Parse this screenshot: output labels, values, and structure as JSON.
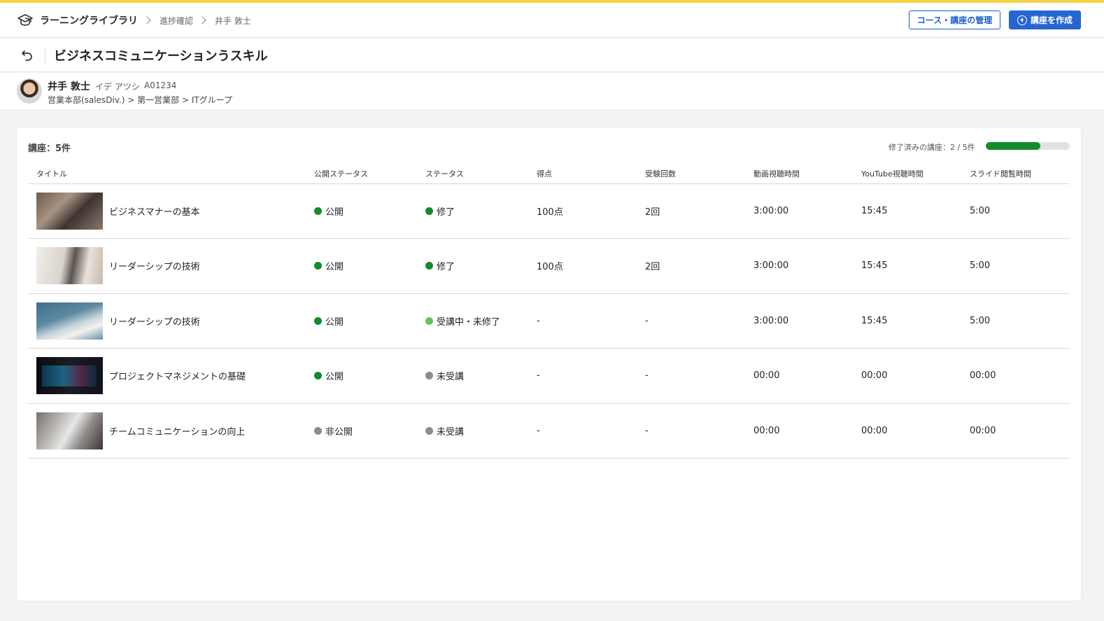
{
  "colors": {
    "accent_line": "#f5d342",
    "primary": "#2566d0",
    "done": "#128b2c",
    "in_progress": "#5cc662",
    "inactive": "#8c8c8c"
  },
  "header": {
    "brand": "ラーニングライブラリ",
    "breadcrumbs": [
      "進捗確認",
      "井手 敦士"
    ],
    "manage_button": "コース・講座の管理",
    "create_button": "講座を作成"
  },
  "titlebar": {
    "title": "ビジネスコミュニケーションうスキル"
  },
  "user": {
    "name": "井手 敦士",
    "kana": "イデ アツシ",
    "id": "A01234",
    "org": "営業本部(salesDiv.) > 第一営業部 > ITグループ"
  },
  "summary": {
    "count_label": "講座：5件",
    "progress_label": "修了済みの講座：2 / 5件",
    "progress_fraction": 0.65
  },
  "table": {
    "columns": [
      "タイトル",
      "公開ステータス",
      "ステータス",
      "得点",
      "受験回数",
      "動画視聴時間",
      "YouTube視聴時間",
      "スライド閲覧時間"
    ],
    "rows": [
      {
        "title": "ビジネスマナーの基本",
        "publish": "公開",
        "publish_color": "done",
        "status": "修了",
        "status_color": "done",
        "score": "100点",
        "attempts": "2回",
        "video": "3:00:00",
        "youtube": "15:45",
        "slide": "5:00"
      },
      {
        "title": "リーダーシップの技術",
        "publish": "公開",
        "publish_color": "done",
        "status": "修了",
        "status_color": "done",
        "score": "100点",
        "attempts": "2回",
        "video": "3:00:00",
        "youtube": "15:45",
        "slide": "5:00"
      },
      {
        "title": "リーダーシップの技術",
        "publish": "公開",
        "publish_color": "done",
        "status": "受講中・未修了",
        "status_color": "in_progress",
        "score": "-",
        "attempts": "-",
        "video": "3:00:00",
        "youtube": "15:45",
        "slide": "5:00"
      },
      {
        "title": "プロジェクトマネジメントの基礎",
        "publish": "公開",
        "publish_color": "done",
        "status": "未受講",
        "status_color": "inactive",
        "score": "-",
        "attempts": "-",
        "video": "00:00",
        "youtube": "00:00",
        "slide": "00:00"
      },
      {
        "title": "チームコミュニケーションの向上",
        "publish": "非公開",
        "publish_color": "inactive",
        "status": "未受講",
        "status_color": "inactive",
        "score": "-",
        "attempts": "-",
        "video": "00:00",
        "youtube": "00:00",
        "slide": "00:00"
      }
    ]
  }
}
